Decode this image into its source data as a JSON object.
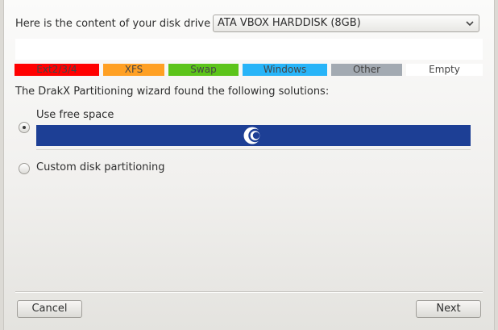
{
  "drive": {
    "label": "Here is the content of your disk drive",
    "selected": "ATA VBOX HARDDISK (8GB)"
  },
  "legend": [
    {
      "label": "Ext2/3/4",
      "color": "#ff0000"
    },
    {
      "label": "XFS",
      "color": "#ffa024"
    },
    {
      "label": "Swap",
      "color": "#5cc41a"
    },
    {
      "label": "Windows",
      "color": "#28b4f8"
    },
    {
      "label": "Other",
      "color": "#a3aab2"
    },
    {
      "label": "Empty",
      "color": "#ffffff"
    }
  ],
  "solutions": {
    "title": "The DrakX Partitioning wizard found the following solutions:",
    "options": [
      {
        "label": "Use free space",
        "selected": true
      },
      {
        "label": "Custom disk partitioning",
        "selected": false
      }
    ],
    "free_space_bar_color": "#1d3f95"
  },
  "buttons": {
    "cancel": "Cancel",
    "next": "Next"
  }
}
